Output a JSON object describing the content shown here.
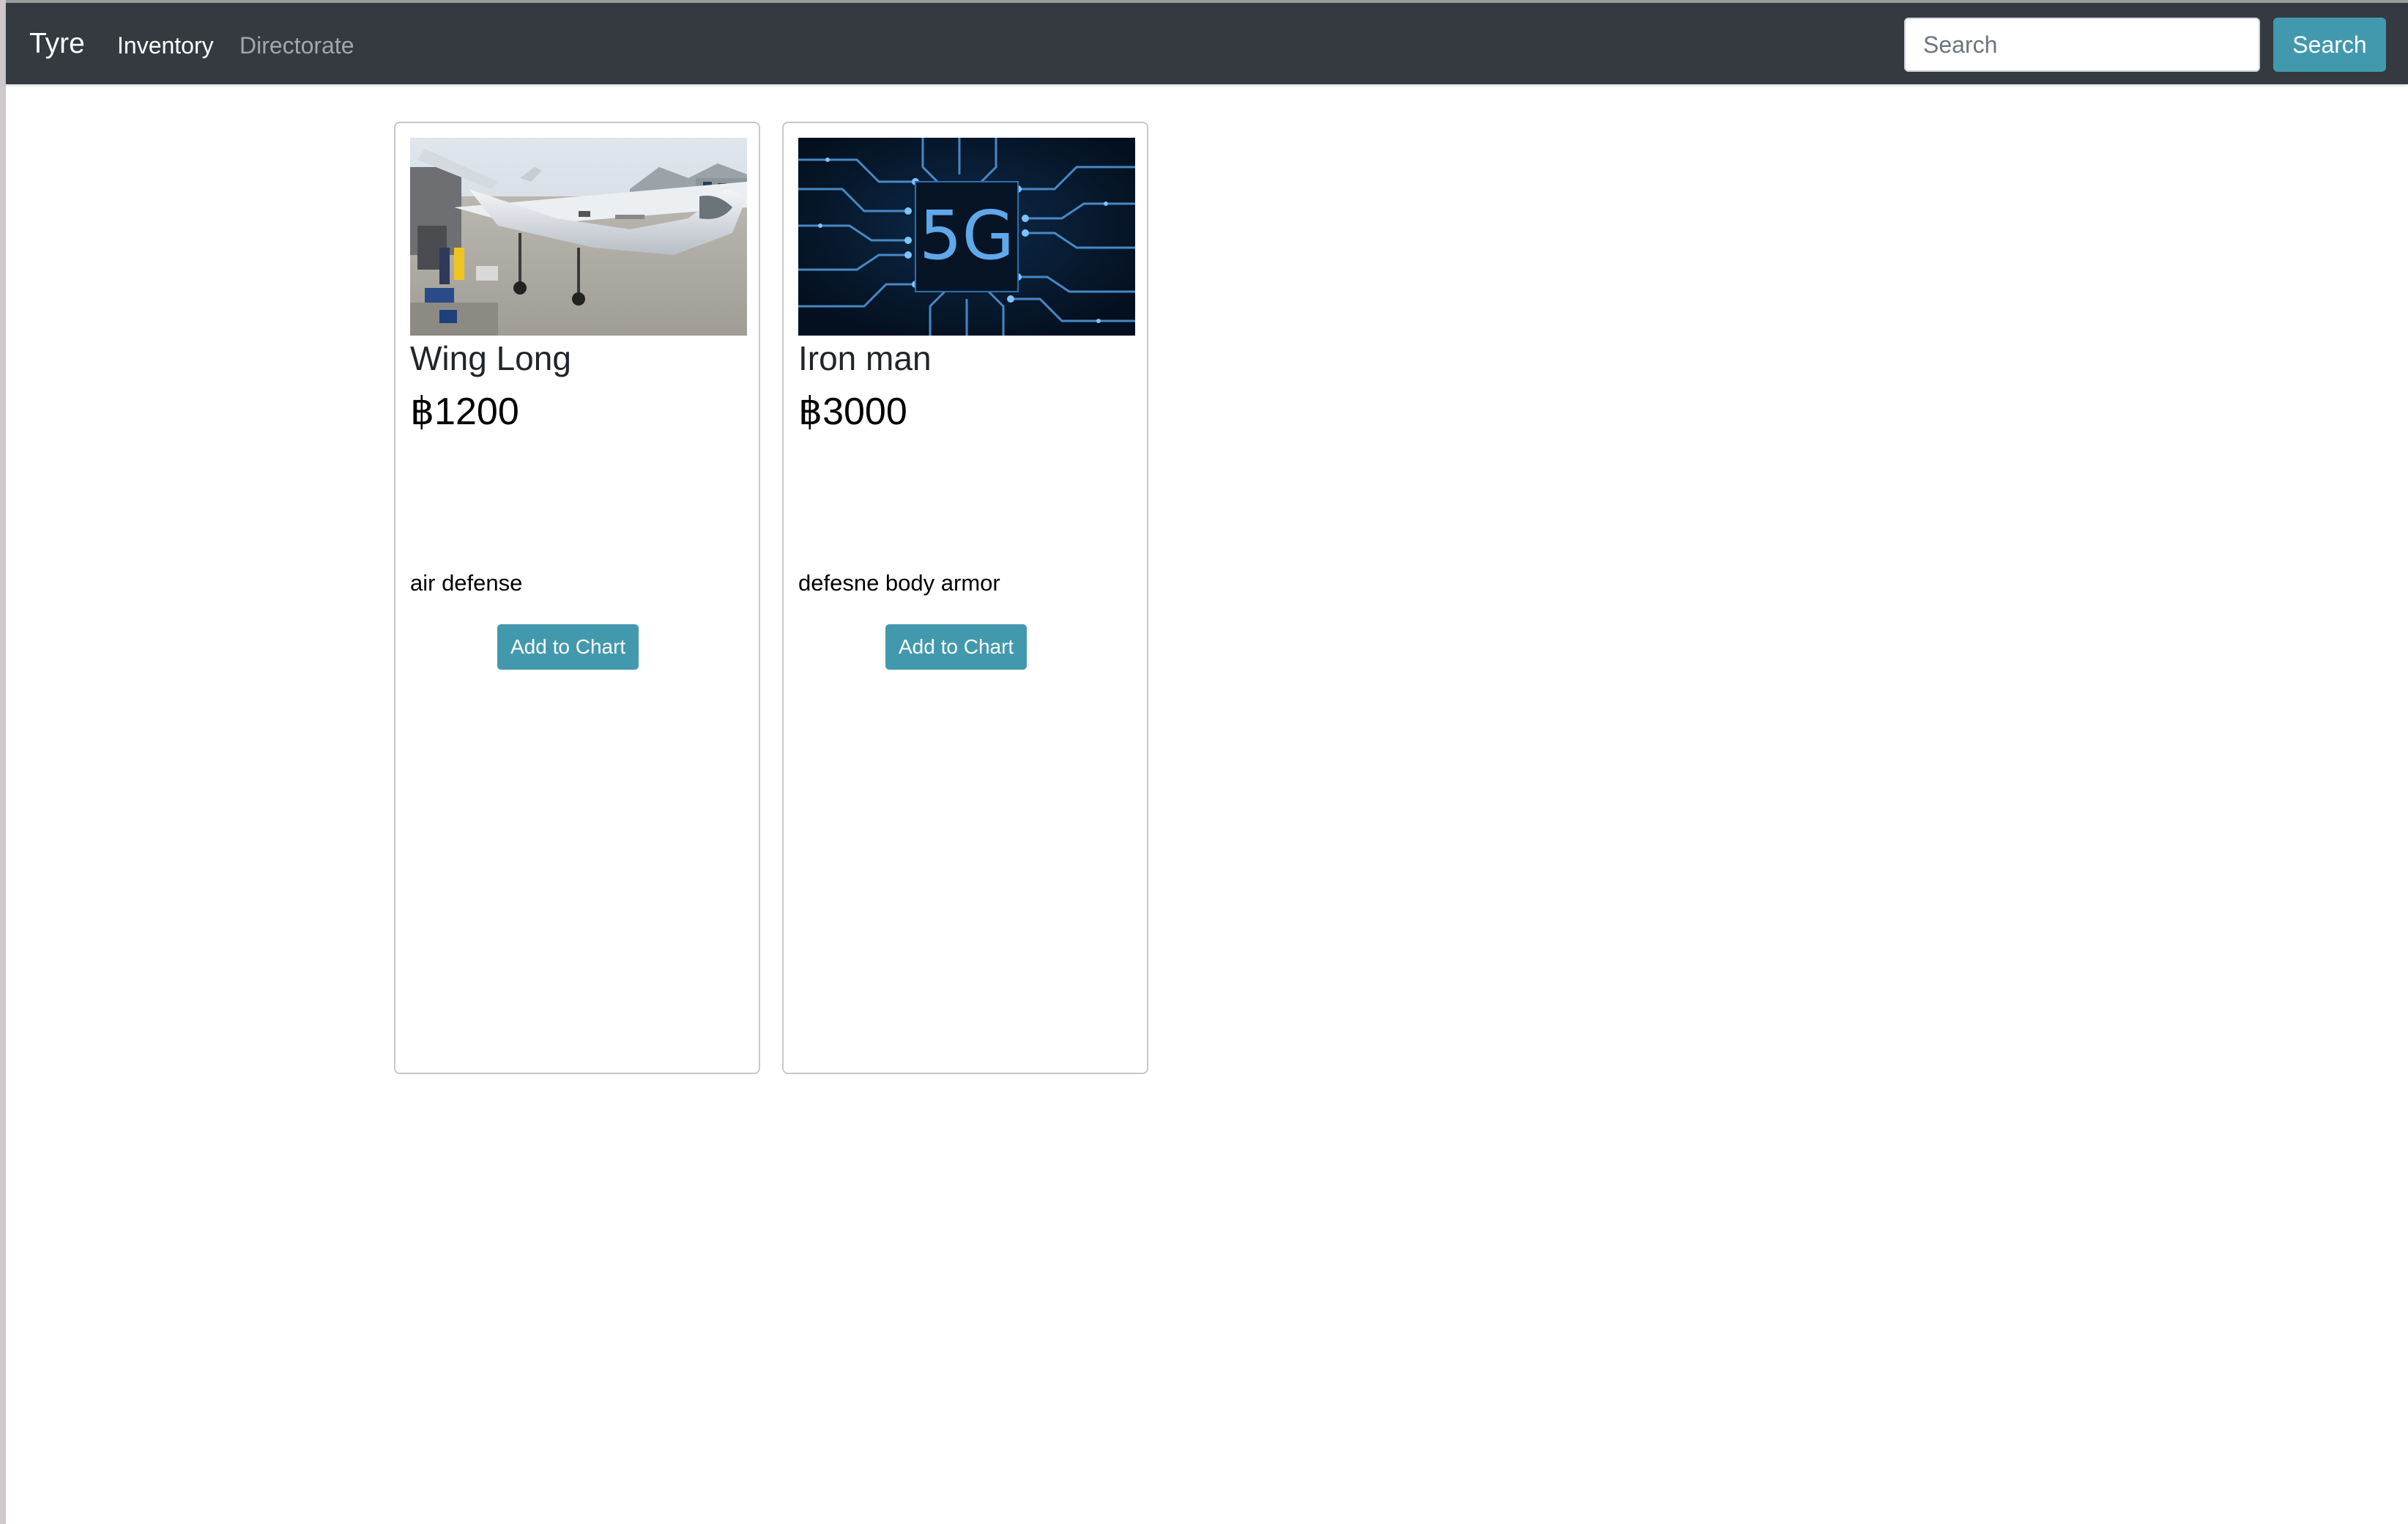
{
  "navbar": {
    "brand": "Tyre",
    "links": [
      {
        "label": "Inventory",
        "active": true
      },
      {
        "label": "Directorate",
        "active": false
      }
    ],
    "search": {
      "placeholder": "Search",
      "button_label": "Search"
    }
  },
  "products": [
    {
      "name": "Wing Long",
      "price": "฿1200",
      "description": "air defense",
      "button_label": "Add to Chart",
      "image": "military-drone-photo"
    },
    {
      "name": "Iron man",
      "price": "฿3000",
      "description": "defesne body armor",
      "button_label": "Add to Chart",
      "image": "5g-circuit-board-photo",
      "image_text": "5G"
    }
  ],
  "colors": {
    "navbar_bg": "#343a40",
    "accent": "#4299ad",
    "card_border": "#c8c8c8"
  }
}
